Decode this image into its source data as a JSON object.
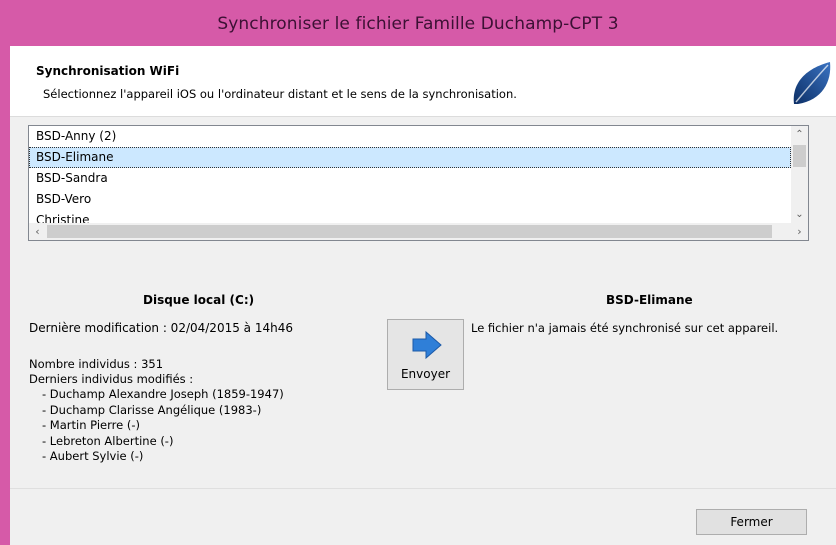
{
  "window": {
    "title": "Synchroniser le fichier Famille Duchamp-CPT 3"
  },
  "header": {
    "title": "Synchronisation WiFi",
    "subtitle": "Sélectionnez l'appareil iOS ou l'ordinateur distant et le sens de la synchronisation."
  },
  "devices": {
    "items": [
      "BSD-Anny (2)",
      "BSD-Elimane",
      "BSD-Sandra",
      "BSD-Vero",
      "Christine"
    ],
    "selected": "BSD-Elimane"
  },
  "local": {
    "title": "Disque local (C:)",
    "last_modified": "Dernière modification : 02/04/2015 à 14h46",
    "individuals_count": "Nombre individus : 351",
    "modified_label": "Derniers individus modifiés :",
    "modified_list": [
      "- Duchamp Alexandre Joseph (1859-1947)",
      "- Duchamp Clarisse Angélique (1983-)",
      "- Martin Pierre (-)",
      "- Lebreton Albertine (-)",
      "- Aubert Sylvie (-)"
    ]
  },
  "remote": {
    "title": "BSD-Elimane",
    "message": "Le fichier n'a jamais été synchronisé sur cet appareil."
  },
  "buttons": {
    "send": "Envoyer",
    "close": "Fermer"
  },
  "icons": {
    "logo": "leaf-logo-icon",
    "send": "arrow-right-icon"
  },
  "colors": {
    "titlebar": "#d65aa8",
    "selection": "#cce8ff",
    "arrow": "#2f7fd8"
  }
}
